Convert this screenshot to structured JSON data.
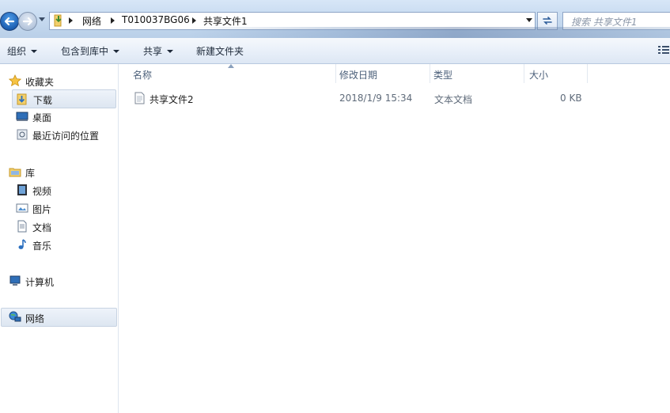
{
  "address": {
    "path": [
      "网络",
      "T010037BG06",
      "共享文件1"
    ],
    "search_placeholder": "搜索 共享文件1"
  },
  "toolbar": {
    "organize": "组织",
    "include_in_library": "包含到库中",
    "share": "共享",
    "new_folder": "新建文件夹"
  },
  "sidebar": {
    "favorites": "收藏夹",
    "downloads": "下载",
    "desktop": "桌面",
    "recent": "最近访问的位置",
    "libraries": "库",
    "videos": "视频",
    "pictures": "图片",
    "documents": "文档",
    "music": "音乐",
    "computer": "计算机",
    "network": "网络"
  },
  "columns": {
    "name": "名称",
    "modified": "修改日期",
    "type": "类型",
    "size": "大小"
  },
  "files": [
    {
      "name": "共享文件2",
      "modified": "2018/1/9 15:34",
      "type": "文本文档",
      "size": "0 KB",
      "icon": "text-document-icon"
    }
  ]
}
